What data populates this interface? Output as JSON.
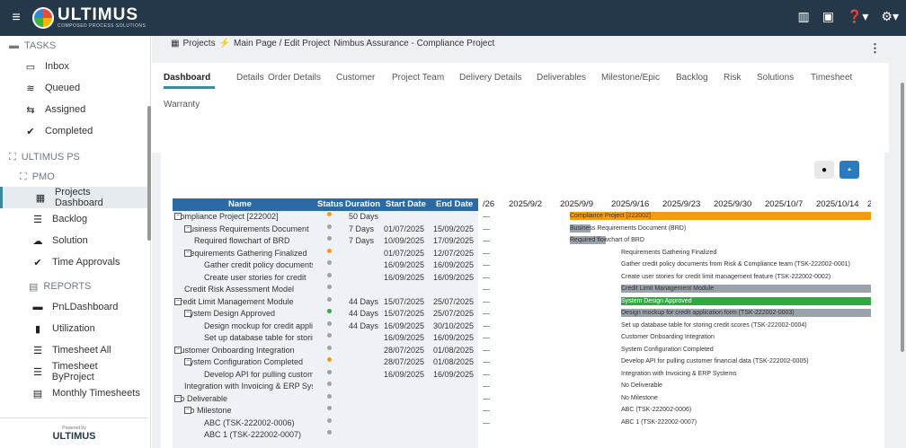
{
  "app": {
    "brand": "ULTIMUS",
    "brand_sub": "COMPOSED PROCESS SOLUTIONS"
  },
  "sidebar": {
    "tasks_header": "TASKS",
    "tasks": [
      {
        "label": "Inbox",
        "icon": "inbox-icon"
      },
      {
        "label": "Queued",
        "icon": "layers-icon"
      },
      {
        "label": "Assigned",
        "icon": "assign-icon"
      },
      {
        "label": "Completed",
        "icon": "check-circle-icon"
      }
    ],
    "ps_header": "ULTIMUS PS",
    "pmo_header": "PMO",
    "pmo": [
      {
        "label": "Projects Dashboard",
        "icon": "table-icon"
      },
      {
        "label": "Backlog",
        "icon": "list-icon"
      },
      {
        "label": "Solution",
        "icon": "bulb-icon"
      },
      {
        "label": "Time Approvals",
        "icon": "check-circle-icon"
      }
    ],
    "reports_header": "REPORTS",
    "reports": [
      {
        "label": "PnLDashboard",
        "icon": "dashboard-icon"
      },
      {
        "label": "Utilization",
        "icon": "doc-icon"
      },
      {
        "label": "Timesheet All",
        "icon": "list-icon"
      },
      {
        "label": "Timesheet ByProject",
        "icon": "list-icon"
      },
      {
        "label": "Monthly Timesheets",
        "icon": "calendar-icon"
      }
    ],
    "powered_by": "Powered by",
    "powered_brand": "ULTIMUS"
  },
  "breadcrumb": {
    "projects": "Projects",
    "main_page": "Main Page / Edit Project",
    "project": "Nimbus Assurance - Compliance Project"
  },
  "tabs": [
    "Dashboard",
    "Details",
    "Order Details",
    "Customer",
    "Project Team",
    "Delivery Details",
    "Deliverables",
    "Milestone/Epic",
    "Backlog",
    "Risk",
    "Solutions",
    "Timesheet",
    "Warranty"
  ],
  "grid": {
    "headers": {
      "name": "Name",
      "status": "Status",
      "duration": "Duration",
      "start": "Start Date",
      "end": "End Date"
    },
    "rows": [
      {
        "name": "Compliance Project [222002]",
        "indent": 0,
        "tree": "−",
        "status": "orange",
        "duration": "50 Days",
        "start": "",
        "end": ""
      },
      {
        "name": "Business Requirements Document",
        "indent": 1,
        "tree": "−",
        "status": "grey",
        "duration": "7 Days",
        "start": "01/07/2025",
        "end": "15/09/2025"
      },
      {
        "name": "Required flowchart of BRD",
        "indent": 2,
        "tree": "",
        "status": "grey",
        "duration": "7 Days",
        "start": "10/09/2025",
        "end": "17/09/2025"
      },
      {
        "name": "Requirements Gathering Finalized",
        "indent": 1,
        "tree": "−",
        "status": "orange",
        "duration": "",
        "start": "01/07/2025",
        "end": "12/07/2025"
      },
      {
        "name": "Gather credit policy documents",
        "indent": 3,
        "tree": "",
        "status": "grey",
        "duration": "",
        "start": "16/09/2025",
        "end": "16/09/2025"
      },
      {
        "name": "Create user stories for credit",
        "indent": 3,
        "tree": "",
        "status": "grey",
        "duration": "",
        "start": "16/09/2025",
        "end": "16/09/2025"
      },
      {
        "name": "Credit Risk Assessment Model",
        "indent": 1,
        "tree": "",
        "status": "grey",
        "duration": "",
        "start": "",
        "end": ""
      },
      {
        "name": "Credit Limit Management Module",
        "indent": 0,
        "tree": "−",
        "status": "grey",
        "duration": "44 Days",
        "start": "15/07/2025",
        "end": "25/07/2025"
      },
      {
        "name": "System Design Approved",
        "indent": 1,
        "tree": "−",
        "status": "green",
        "duration": "44 Days",
        "start": "15/07/2025",
        "end": "25/07/2025"
      },
      {
        "name": "Design mockup for credit application",
        "indent": 3,
        "tree": "",
        "status": "grey",
        "duration": "44 Days",
        "start": "16/09/2025",
        "end": "30/10/2025"
      },
      {
        "name": "Set up database table for storing",
        "indent": 3,
        "tree": "",
        "status": "grey",
        "duration": "",
        "start": "16/09/2025",
        "end": "16/09/2025"
      },
      {
        "name": "Customer Onboarding Integration",
        "indent": 0,
        "tree": "−",
        "status": "grey",
        "duration": "",
        "start": "28/07/2025",
        "end": "01/08/2025"
      },
      {
        "name": "System Configuration Completed",
        "indent": 1,
        "tree": "−",
        "status": "orange",
        "duration": "",
        "start": "28/07/2025",
        "end": "01/08/2025"
      },
      {
        "name": "Develop API for pulling customer",
        "indent": 3,
        "tree": "",
        "status": "grey",
        "duration": "",
        "start": "16/09/2025",
        "end": "16/09/2025"
      },
      {
        "name": "Integration with Invoicing & ERP Systems",
        "indent": 1,
        "tree": "",
        "status": "grey",
        "duration": "",
        "start": "",
        "end": ""
      },
      {
        "name": "No Deliverable",
        "indent": 0,
        "tree": "−",
        "status": "grey",
        "duration": "",
        "start": "",
        "end": ""
      },
      {
        "name": "No Milestone",
        "indent": 1,
        "tree": "−",
        "status": "grey",
        "duration": "",
        "start": "",
        "end": ""
      },
      {
        "name": "ABC (TSK-222002-0006)",
        "indent": 3,
        "tree": "",
        "status": "grey",
        "duration": "",
        "start": "",
        "end": ""
      },
      {
        "name": "ABC 1 (TSK-222002-0007)",
        "indent": 3,
        "tree": "",
        "status": "grey",
        "duration": "",
        "start": "",
        "end": ""
      }
    ]
  },
  "gantt": {
    "dates": [
      "/26",
      "2025/9/2",
      "2025/9/9",
      "2025/9/16",
      "2025/9/23",
      "2025/9/30",
      "2025/10/7",
      "2025/10/14",
      "20"
    ],
    "rows": [
      {
        "label": "Compliance Project [222002]",
        "bar": "orange",
        "start": 2,
        "end": 8
      },
      {
        "label": "Business Requirements Document (BRD)",
        "bar": "grey",
        "start": 2,
        "end": 2.4
      },
      {
        "label": "Required flowchart of BRD",
        "bar": "grey",
        "start": 2,
        "end": 2.7
      },
      {
        "label": "Requirements Gathering Finalized",
        "bar": "",
        "start": 3,
        "end": 3
      },
      {
        "label": "Gather credit policy documents from Risk & Compliance team (TSK-222002-0001)",
        "bar": "",
        "start": 3,
        "end": 3
      },
      {
        "label": "Create user stories for credit limit management feature (TSK-222002-0002)",
        "bar": "",
        "start": 3,
        "end": 3
      },
      {
        "label": "Credit Limit Management Module",
        "bar": "grey",
        "start": 3,
        "end": 8
      },
      {
        "label": "System Design Approved",
        "bar": "green",
        "start": 3,
        "end": 8
      },
      {
        "label": "Design mockup for credit application form (TSK-222002-0003)",
        "bar": "grey",
        "start": 3,
        "end": 8
      },
      {
        "label": "Set up database table for storing credit scores (TSK-222002-0004)",
        "bar": "",
        "start": 3,
        "end": 3
      },
      {
        "label": "Customer Onboarding Integration",
        "bar": "",
        "start": 3,
        "end": 3
      },
      {
        "label": "System Configuration Completed",
        "bar": "",
        "start": 3,
        "end": 3
      },
      {
        "label": "Develop API for pulling customer financial data (TSK-222002-0005)",
        "bar": "",
        "start": 3,
        "end": 3
      },
      {
        "label": "Integration with Invoicing & ERP Systems",
        "bar": "",
        "start": 3,
        "end": 3
      },
      {
        "label": "No Deliverable",
        "bar": "",
        "start": 3,
        "end": 3
      },
      {
        "label": "No Milestone",
        "bar": "",
        "start": 3,
        "end": 3
      },
      {
        "label": "ABC (TSK-222002-0006)",
        "bar": "",
        "start": 3,
        "end": 3
      },
      {
        "label": "ABC 1 (TSK-222002-0007)",
        "bar": "",
        "start": 3,
        "end": 3
      }
    ]
  },
  "colors": {
    "orange": "#f39c12",
    "grey": "#9aa3ab",
    "green": "#2eaa3f"
  }
}
